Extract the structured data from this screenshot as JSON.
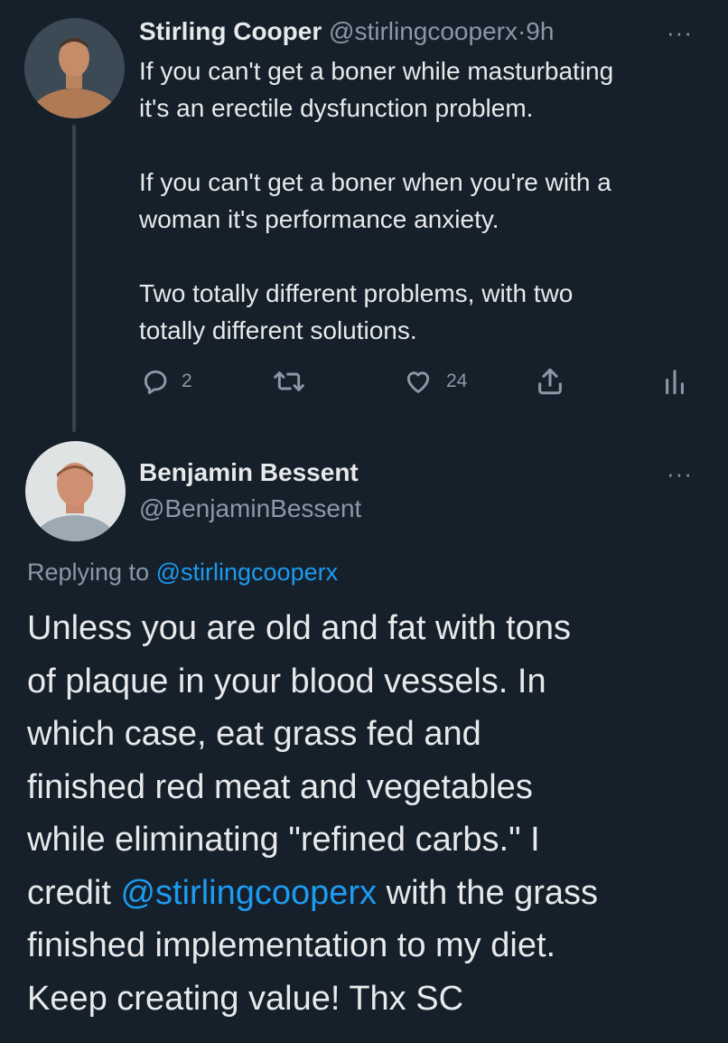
{
  "tweet1": {
    "author_name": "Stirling Cooper",
    "handle": "@stirlingcooperx",
    "separator": "·",
    "time": "9h",
    "more_icon": "more-horizontal-icon",
    "text": "If you can't get a boner while masturbating\nit's an erectile dysfunction problem.\n\nIf you can't get a boner when you're with a\nwoman it's performance anxiety.\n\nTwo totally different problems, with two\ntotally different solutions.",
    "replies": "2",
    "likes": "24"
  },
  "tweet2": {
    "author_name": "Benjamin Bessent",
    "handle": "@BenjaminBessent",
    "replying_label": "Replying to",
    "replying_handle": "@stirlingcooperx",
    "text_lines": [
      "Unless you are old and fat with tons",
      "of plaque in your blood vessels. In",
      "which case, eat grass fed and",
      "finished red meat and vegetables",
      "while eliminating \"refined carbs.\" I"
    ],
    "line6_prefix": "credit ",
    "line6_mention": "@stirlingcooperx",
    "line6_suffix": " with the grass",
    "text_lines_end": [
      "finished implementation to my diet.",
      "Keep creating value! Thx SC"
    ]
  },
  "colors": {
    "background": "#15202b",
    "text": "#e7e9ea",
    "muted": "#8b98a5",
    "link": "#1d9bf0"
  }
}
